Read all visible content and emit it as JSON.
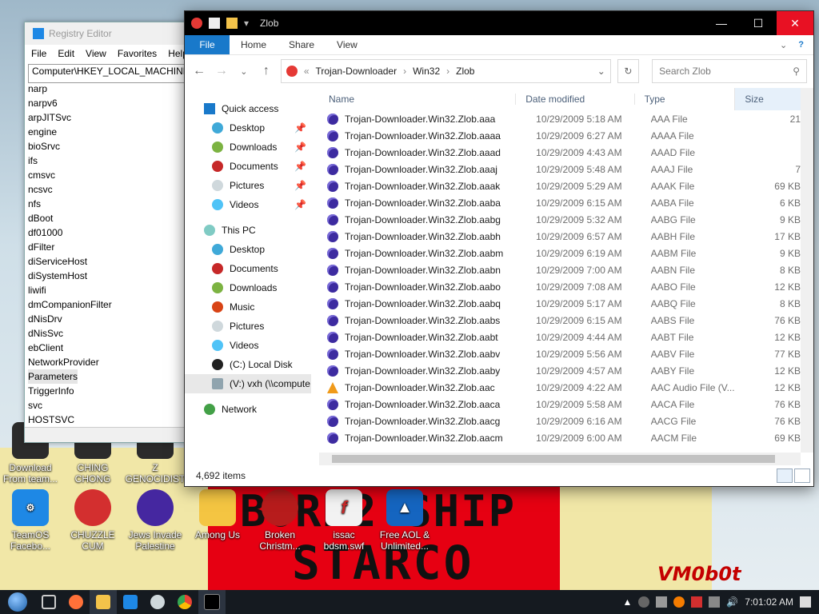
{
  "desktop": {
    "background_text": {
      "line1": "BORN2 SHIP",
      "line2": "STARCO",
      "signature": "VM0b0t"
    },
    "icons": [
      {
        "label": "Download From team...",
        "name": "download-from-team-icon",
        "color": "#2b2b2b"
      },
      {
        "label": "CHING CHONG",
        "name": "ching-chong-icon",
        "color": "#2b2b2b"
      },
      {
        "label": "Z GENOCIDIST",
        "name": "z-genocidist-icon",
        "color": "#2b2b2b"
      },
      {
        "label": "TeamOS Facebo...",
        "name": "teamos-facebook-icon",
        "color": "#1e88e5"
      },
      {
        "label": "CHUZZLE CUM",
        "name": "chuzzle-icon",
        "color": "#d32f2f"
      },
      {
        "label": "Jews Invade Palestine",
        "name": "jews-invade-palestine-icon",
        "color": "#4527a0"
      },
      {
        "label": "Among Us",
        "name": "among-us-icon",
        "color": "#f4c542"
      },
      {
        "label": "Broken Christm...",
        "name": "broken-christmas-icon",
        "color": "#b71c1c"
      },
      {
        "label": "issac bdsm.swf",
        "name": "swf-file-icon",
        "color": "#c62828"
      },
      {
        "label": "Free AOL & Unlimited...",
        "name": "free-aol-icon",
        "color": "#1565c0"
      }
    ]
  },
  "regedit": {
    "title": "Registry Editor",
    "menu": [
      "File",
      "Edit",
      "View",
      "Favorites",
      "Help"
    ],
    "address": "Computer\\HKEY_LOCAL_MACHINE",
    "tree_items": [
      "narp",
      "narpv6",
      "arpJITSvc",
      "engine",
      "bioSrvc",
      "ifs",
      "cmsvc",
      "ncsvc",
      "nfs",
      "dBoot",
      "df01000",
      "dFilter",
      "diServiceHost",
      "diSystemHost",
      "liwifi",
      "dmCompanionFilter",
      "dNisDrv",
      "dNisSvc",
      "ebClient",
      "NetworkProvider",
      "Parameters",
      "TriggerInfo",
      "svc",
      "HOSTSVC"
    ],
    "selected": "Parameters"
  },
  "explorer": {
    "title": "Zlob",
    "ribbon": {
      "file": "File",
      "tabs": [
        "Home",
        "Share",
        "View"
      ]
    },
    "address": {
      "crumbs": [
        "Trojan-Downloader",
        "Win32",
        "Zlob"
      ],
      "prefix": "«"
    },
    "search_placeholder": "Search Zlob",
    "nav": {
      "quick_access": "Quick access",
      "quick_items": [
        "Desktop",
        "Downloads",
        "Documents",
        "Pictures",
        "Videos"
      ],
      "this_pc": "This PC",
      "pc_items": [
        "Desktop",
        "Documents",
        "Downloads",
        "Music",
        "Pictures",
        "Videos",
        "(C:) Local Disk",
        "(V:) vxh (\\\\compute"
      ],
      "network": "Network"
    },
    "columns": [
      "Name",
      "Date modified",
      "Type",
      "Size"
    ],
    "files": [
      {
        "name": "Trojan-Downloader.Win32.Zlob.aaa",
        "date": "10/29/2009 5:18 AM",
        "type": "AAA File",
        "size": "21",
        "icon": "orb"
      },
      {
        "name": "Trojan-Downloader.Win32.Zlob.aaaa",
        "date": "10/29/2009 6:27 AM",
        "type": "AAAA File",
        "size": "",
        "icon": "orb"
      },
      {
        "name": "Trojan-Downloader.Win32.Zlob.aaad",
        "date": "10/29/2009 4:43 AM",
        "type": "AAAD File",
        "size": "",
        "icon": "orb"
      },
      {
        "name": "Trojan-Downloader.Win32.Zlob.aaaj",
        "date": "10/29/2009 5:48 AM",
        "type": "AAAJ File",
        "size": "7",
        "icon": "orb"
      },
      {
        "name": "Trojan-Downloader.Win32.Zlob.aaak",
        "date": "10/29/2009 5:29 AM",
        "type": "AAAK File",
        "size": "69 KB",
        "icon": "orb"
      },
      {
        "name": "Trojan-Downloader.Win32.Zlob.aaba",
        "date": "10/29/2009 6:15 AM",
        "type": "AABA File",
        "size": "6 KB",
        "icon": "orb"
      },
      {
        "name": "Trojan-Downloader.Win32.Zlob.aabg",
        "date": "10/29/2009 5:32 AM",
        "type": "AABG File",
        "size": "9 KB",
        "icon": "orb"
      },
      {
        "name": "Trojan-Downloader.Win32.Zlob.aabh",
        "date": "10/29/2009 6:57 AM",
        "type": "AABH File",
        "size": "17 KB",
        "icon": "orb"
      },
      {
        "name": "Trojan-Downloader.Win32.Zlob.aabm",
        "date": "10/29/2009 6:19 AM",
        "type": "AABM File",
        "size": "9 KB",
        "icon": "orb"
      },
      {
        "name": "Trojan-Downloader.Win32.Zlob.aabn",
        "date": "10/29/2009 7:00 AM",
        "type": "AABN File",
        "size": "8 KB",
        "icon": "orb"
      },
      {
        "name": "Trojan-Downloader.Win32.Zlob.aabo",
        "date": "10/29/2009 7:08 AM",
        "type": "AABO File",
        "size": "12 KB",
        "icon": "orb"
      },
      {
        "name": "Trojan-Downloader.Win32.Zlob.aabq",
        "date": "10/29/2009 5:17 AM",
        "type": "AABQ File",
        "size": "8 KB",
        "icon": "orb"
      },
      {
        "name": "Trojan-Downloader.Win32.Zlob.aabs",
        "date": "10/29/2009 6:15 AM",
        "type": "AABS File",
        "size": "76 KB",
        "icon": "orb"
      },
      {
        "name": "Trojan-Downloader.Win32.Zlob.aabt",
        "date": "10/29/2009 4:44 AM",
        "type": "AABT File",
        "size": "12 KB",
        "icon": "orb"
      },
      {
        "name": "Trojan-Downloader.Win32.Zlob.aabv",
        "date": "10/29/2009 5:56 AM",
        "type": "AABV File",
        "size": "77 KB",
        "icon": "orb"
      },
      {
        "name": "Trojan-Downloader.Win32.Zlob.aaby",
        "date": "10/29/2009 4:57 AM",
        "type": "AABY File",
        "size": "12 KB",
        "icon": "orb"
      },
      {
        "name": "Trojan-Downloader.Win32.Zlob.aac",
        "date": "10/29/2009 4:22 AM",
        "type": "AAC Audio File (V...",
        "size": "12 KB",
        "icon": "audio"
      },
      {
        "name": "Trojan-Downloader.Win32.Zlob.aaca",
        "date": "10/29/2009 5:58 AM",
        "type": "AACA File",
        "size": "76 KB",
        "icon": "orb"
      },
      {
        "name": "Trojan-Downloader.Win32.Zlob.aacg",
        "date": "10/29/2009 6:16 AM",
        "type": "AACG File",
        "size": "76 KB",
        "icon": "orb"
      },
      {
        "name": "Trojan-Downloader.Win32.Zlob.aacm",
        "date": "10/29/2009 6:00 AM",
        "type": "AACM File",
        "size": "69 KB",
        "icon": "orb"
      }
    ],
    "status": "4,692 items"
  },
  "taskbar": {
    "clock": "7:01:02 AM",
    "items": [
      "start-button",
      "task-view",
      "firefox",
      "file-explorer",
      "store",
      "settings",
      "chrome",
      "terminal"
    ]
  }
}
